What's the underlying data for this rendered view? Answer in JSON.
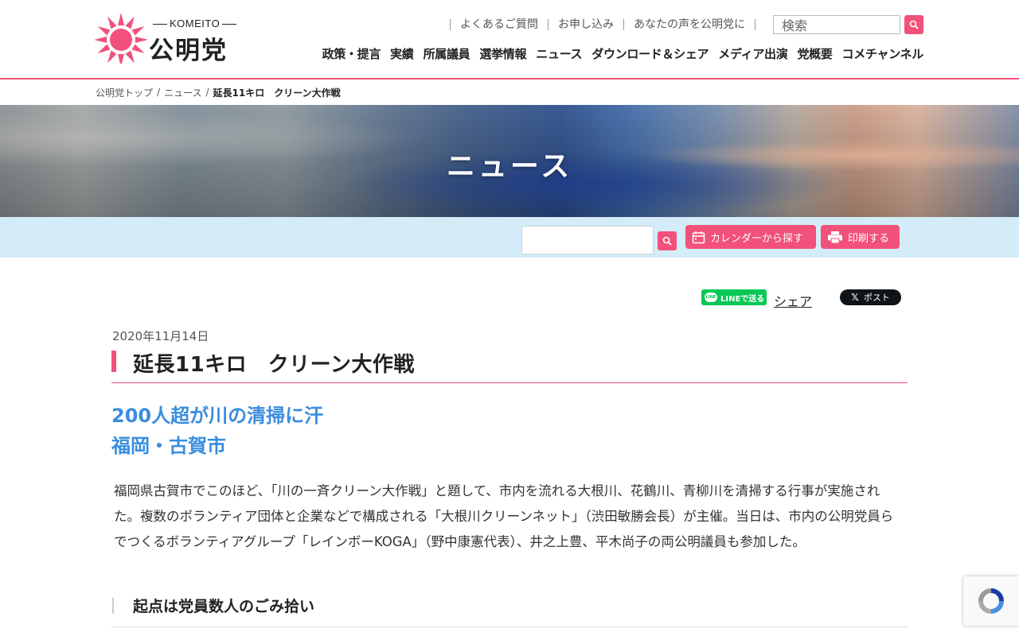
{
  "logo": {
    "top_text": "KOMEITO",
    "main_text": "公明党",
    "sun_color": "#f1517a"
  },
  "util_links": [
    "よくあるご質問",
    "お申し込み",
    "あなたの声を公明党に"
  ],
  "search": {
    "value": "検索"
  },
  "gnav": [
    "政策・提言",
    "実績",
    "所属議員",
    "選挙情報",
    "ニュース",
    "ダウンロード＆シェア",
    "メディア出演",
    "党概要",
    "コメチャンネル"
  ],
  "breadcrumb": {
    "items": [
      "公明党トップ",
      "ニュース"
    ],
    "separator": "/",
    "current": "延長11キロ　クリーン大作戦"
  },
  "hero": {
    "title": "ニュース"
  },
  "toolbar": {
    "calendar_label": "カレンダーから探す",
    "print_label": "印刷する"
  },
  "share": {
    "line_label": "LINEで送る",
    "line_logo": "LINE",
    "share_label": "シェア",
    "x_label": "ポスト",
    "x_logo": "𝕏"
  },
  "article": {
    "date": "2020年11月14日",
    "title": "延長11キロ　クリーン大作戦",
    "subtitle_1": "200人超が川の清掃に汗",
    "subtitle_2": "福岡・古賀市",
    "body": "福岡県古賀市でこのほど、「川の一斉クリーン大作戦」と題して、市内を流れる大根川、花鶴川、青柳川を清掃する行事が実施された。複数のボランティア団体と企業などで構成される「大根川クリーンネット」（渋田敏勝会長）が主催。当日は、市内の公明党員らでつくるボランティアグループ「レインボーKOGA」（野中康憲代表）、井之上豊、平木尚子の両公明議員も参加した。",
    "heading_1": "起点は党員数人のごみ拾い"
  },
  "colors": {
    "accent": "#f1517a",
    "subtitle": "#3a8dde",
    "toolbar_bg": "#d4ecf8"
  }
}
